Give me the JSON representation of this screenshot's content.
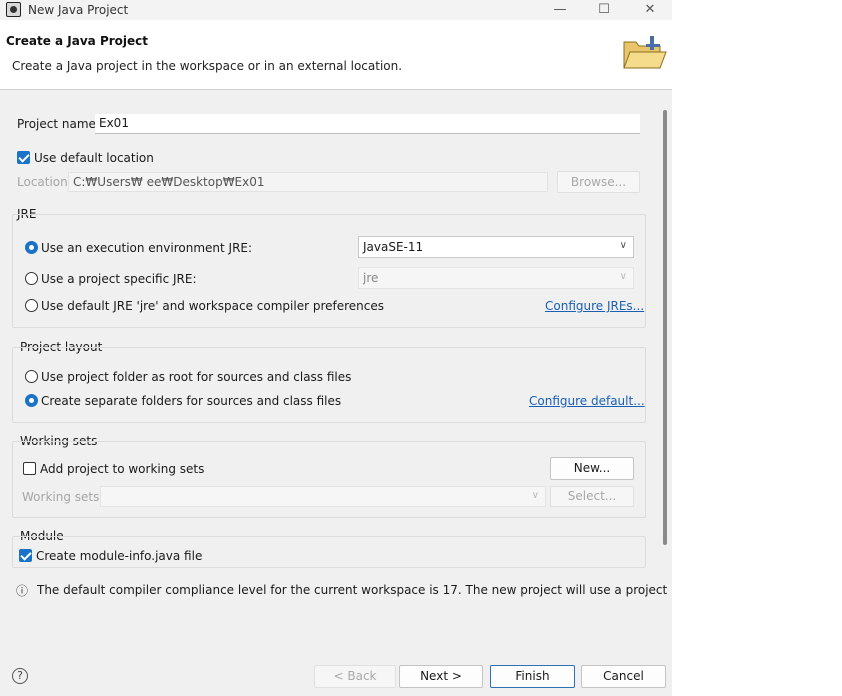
{
  "window": {
    "title": "New Java Project",
    "minimize": "—",
    "maximize": "☐",
    "close": "✕"
  },
  "header": {
    "title": "Create a Java Project",
    "description": "Create a Java project in the workspace or in an external location."
  },
  "project_name": {
    "label": "Project name:",
    "value": "Ex01"
  },
  "location": {
    "use_default_label": "Use default location",
    "use_default_checked": true,
    "label": "Location:",
    "value": "C:₩Users₩            ee₩Desktop₩Ex01",
    "browse_label": "Browse..."
  },
  "jre": {
    "group_label": "JRE",
    "option_env_label": "Use an execution environment JRE:",
    "option_env_value": "JavaSE-11",
    "option_specific_label": "Use a project specific JRE:",
    "option_specific_value": "jre",
    "option_default_label": "Use default JRE 'jre' and workspace compiler preferences",
    "configure_link": "Configure JREs...",
    "selected": "execution_environment"
  },
  "layout": {
    "group_label": "Project layout",
    "option_root_label": "Use project folder as root for sources and class files",
    "option_separate_label": "Create separate folders for sources and class files",
    "configure_link": "Configure default...",
    "selected": "separate"
  },
  "working_sets": {
    "group_label": "Working sets",
    "add_label": "Add project to working sets",
    "add_checked": false,
    "new_label": "New...",
    "sets_label": "Working sets:",
    "select_label": "Select..."
  },
  "module": {
    "group_label": "Module",
    "create_label": "Create module-info.java file",
    "create_checked": true
  },
  "info": {
    "icon": "ⓘ",
    "message": "The default compiler compliance level for the current workspace is 17. The new project will use a project"
  },
  "footer": {
    "help": "?",
    "back_label": "< Back",
    "next_label": "Next >",
    "finish_label": "Finish",
    "cancel_label": "Cancel"
  },
  "colors": {
    "accent": "#1a73c7",
    "link": "#1a5fb4",
    "dialog_bg": "#f0f0f0"
  }
}
